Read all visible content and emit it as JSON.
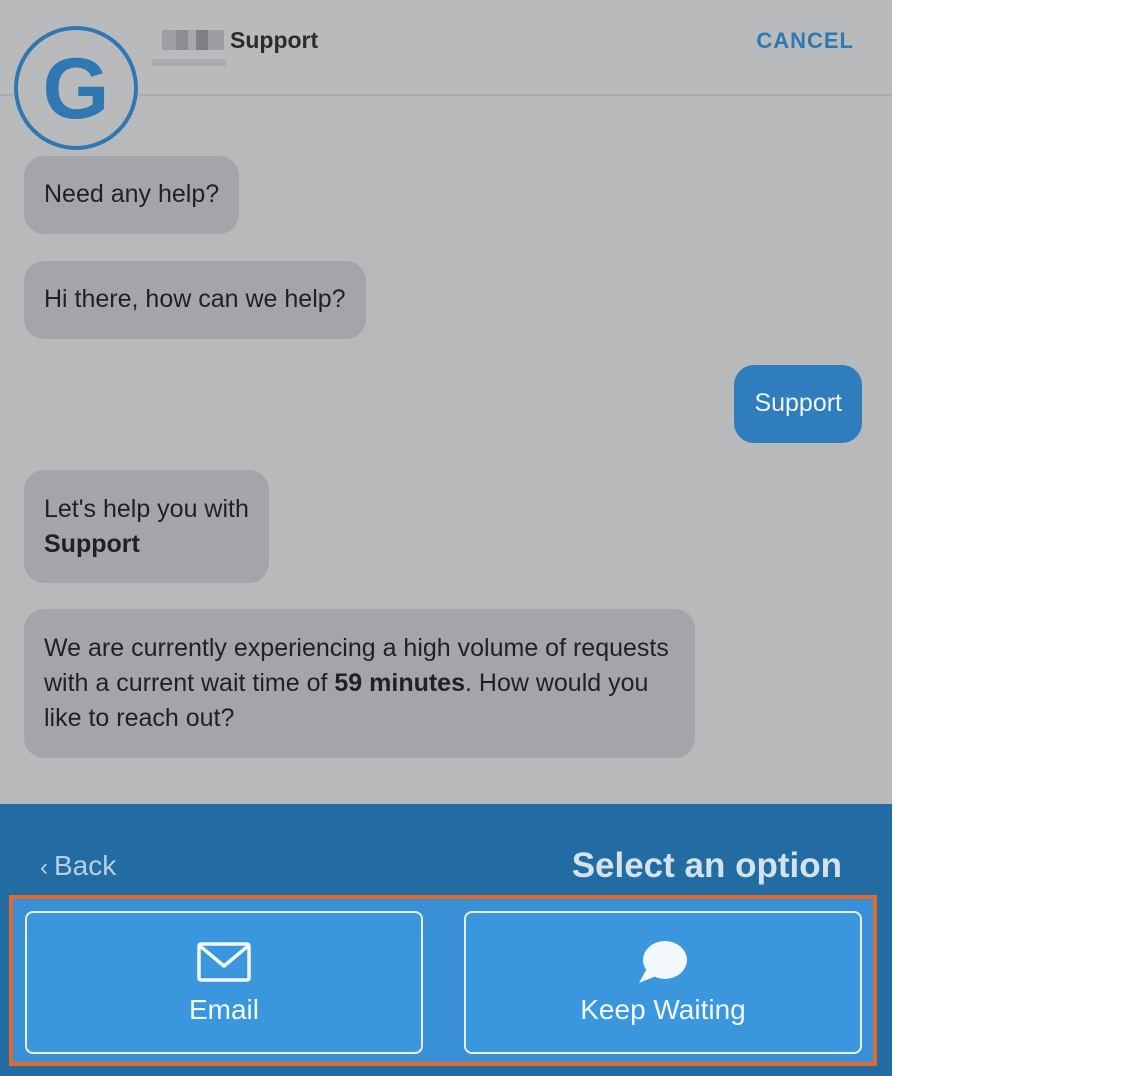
{
  "header": {
    "logo_letter": "G",
    "title": "Support",
    "cancel_label": "CANCEL"
  },
  "messages": [
    {
      "from": "agent",
      "text": "Need any help?"
    },
    {
      "from": "agent",
      "text": "Hi there, how can we help?"
    },
    {
      "from": "user",
      "text": "Support"
    },
    {
      "from": "agent",
      "text_line1": "Let's help you with",
      "text_bold": "Support"
    },
    {
      "from": "agent",
      "text_part1": "We are currently experiencing a high volume of requests with a current wait time of ",
      "text_bold": "59 minutes",
      "text_part2": ". How would you like to reach out?"
    }
  ],
  "bottom": {
    "back_label": "Back",
    "title": "Select an option",
    "options": [
      {
        "label": "Email",
        "icon": "envelope-icon"
      },
      {
        "label": "Keep Waiting",
        "icon": "chat-bubble-icon"
      }
    ]
  },
  "colors": {
    "accent": "#2f78b2",
    "panel": "#236ca3",
    "button": "#3a97de",
    "highlight": "#e06a2c"
  }
}
